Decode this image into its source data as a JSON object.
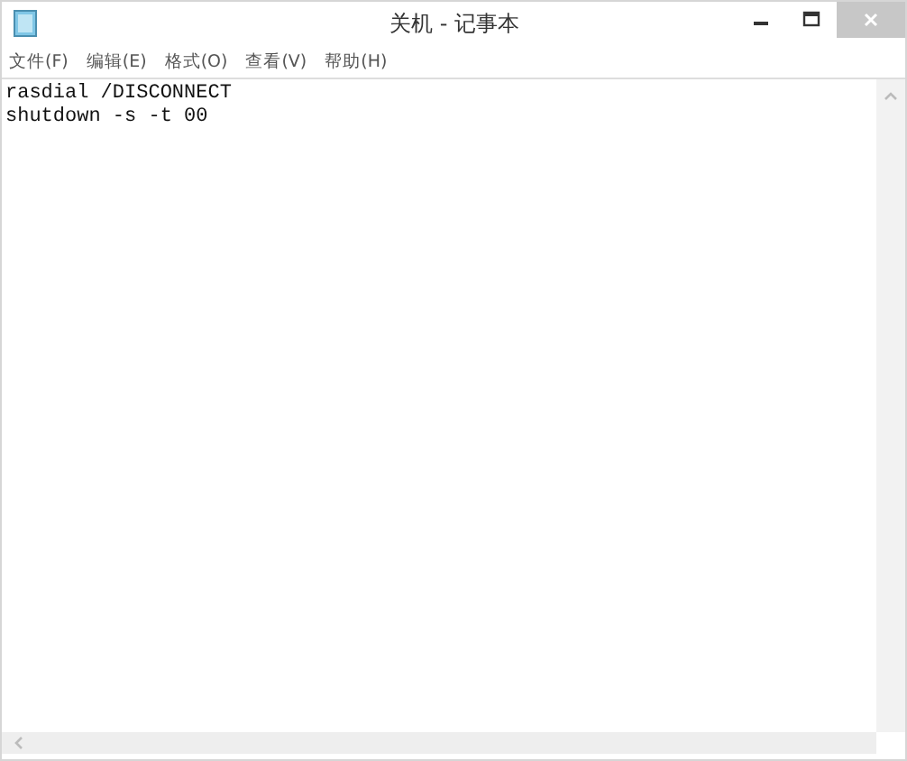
{
  "window": {
    "title": "关机 - 记事本"
  },
  "menu": [
    {
      "label": "文件(F)"
    },
    {
      "label": "编辑(E)"
    },
    {
      "label": "格式(O)"
    },
    {
      "label": "查看(V)"
    },
    {
      "label": "帮助(H)"
    }
  ],
  "editor": {
    "lines": [
      "rasdial /DISCONNECT",
      "shutdown -s -t 00"
    ]
  }
}
